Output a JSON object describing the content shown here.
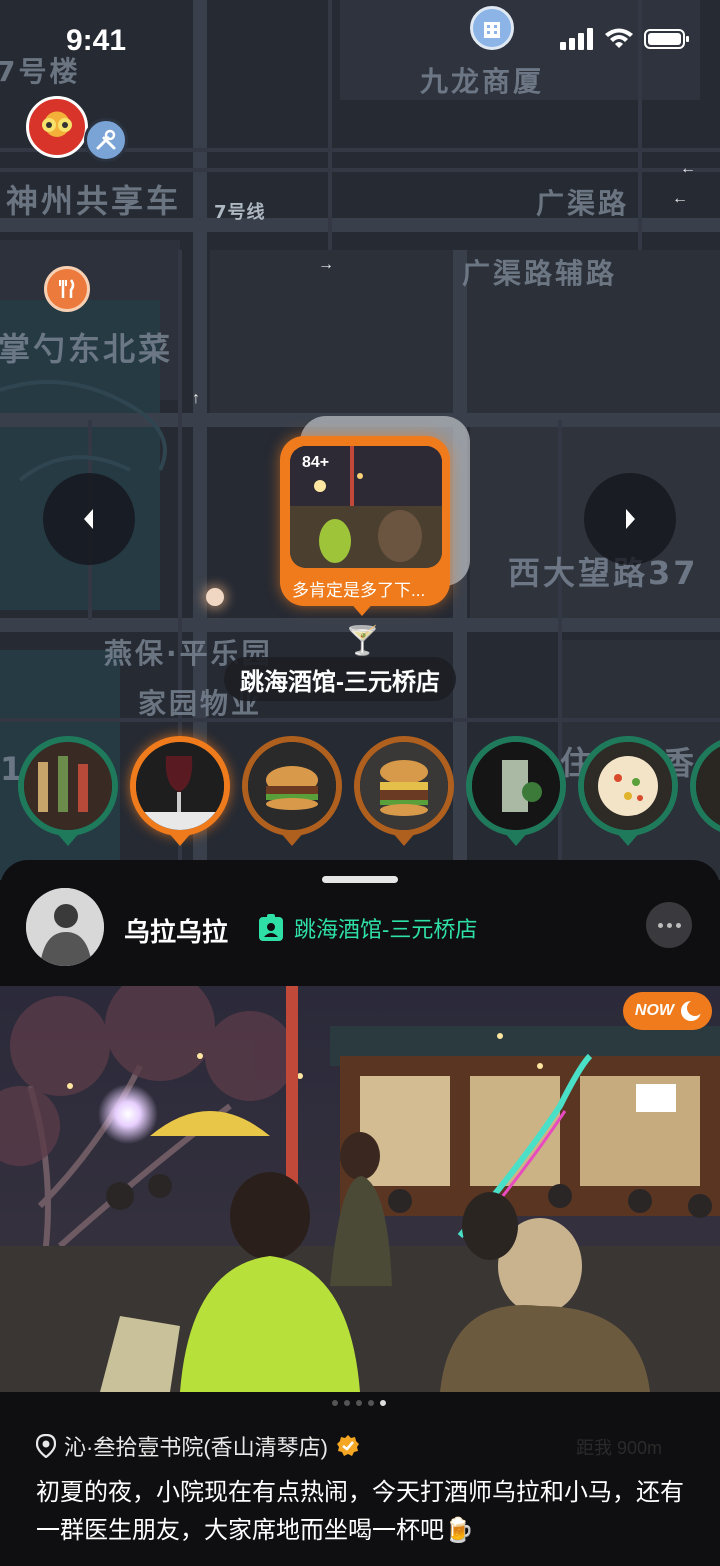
{
  "status_bar": {
    "time": "9:41"
  },
  "map": {
    "labels": {
      "building_top_left": "7号楼",
      "jiulong": "九龙商厦",
      "shenzhou": "神州共享车",
      "line7": "7号线",
      "guangqu": "广渠路",
      "guangqu_fu": "广渠路辅路",
      "zhangshao": "掌勺东北菜",
      "xidawang": "西大望路37",
      "yanbao_1": "燕保·平乐园",
      "yanbao_2": "家园物业",
      "zhu": "住",
      "xiang": "香",
      "num": "1"
    },
    "post_pin": {
      "count": "84+",
      "caption": "多肯定是多了下..."
    },
    "venue_label": "跳海酒馆-三元桥店",
    "bubbles": [
      {
        "name": "bar-bottles",
        "color": "green"
      },
      {
        "name": "wine-glass",
        "color": "active"
      },
      {
        "name": "burger",
        "color": "orange"
      },
      {
        "name": "burger-stack",
        "color": "orange"
      },
      {
        "name": "cocktail",
        "color": "green"
      },
      {
        "name": "pizza",
        "color": "green"
      },
      {
        "name": "partial",
        "color": "green"
      }
    ]
  },
  "post": {
    "user_name": "乌拉乌拉",
    "venue": "跳海酒馆-三元桥店",
    "now_badge": "NOW",
    "location": "沁·叁拾壹书院(香山清琴店)",
    "distance": "距我 900m",
    "text": "初夏的夜，小院现在有点热闹，今天打酒师乌拉和小马，还有一群医生朋友，大家席地而坐喝一杯吧🍺",
    "page_dots": 5,
    "page_index": 5
  },
  "colors": {
    "accent": "#f07b1c",
    "venue_green": "#2fe0a6",
    "map_bg": "#262a33"
  }
}
